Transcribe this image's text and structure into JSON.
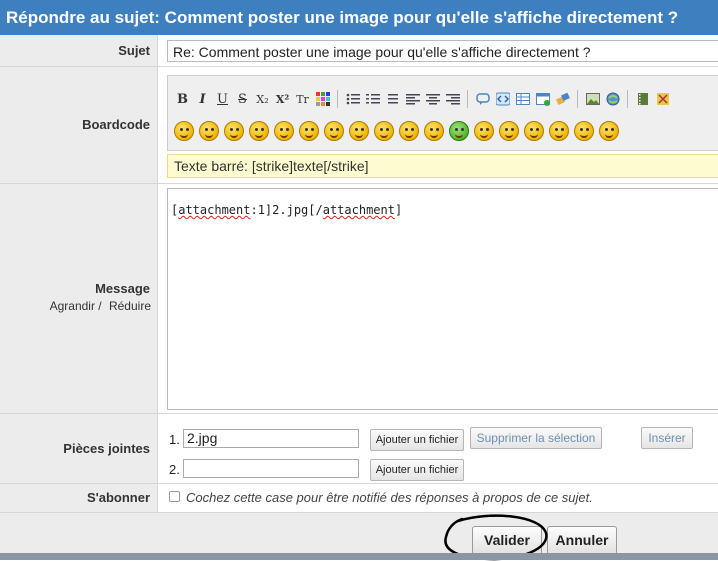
{
  "header": {
    "title": "Répondre au sujet: Comment poster une image pour qu'elle s'affiche directement ?"
  },
  "subject": {
    "label": "Sujet",
    "value": "Re: Comment poster une image pour qu'elle s'affiche directement ?"
  },
  "boardcode": {
    "label": "Boardcode",
    "format_buttons": [
      "B",
      "I",
      "U",
      "S",
      "X₂",
      "X²",
      "Tr"
    ],
    "hint": "Texte barré: [strike]texte[/strike]",
    "smiley_count": 18
  },
  "message": {
    "label": "Message",
    "resize_grow": "Agrandir /",
    "resize_shrink": "Réduire",
    "text_open_tag": "attachment",
    "text_prefix": "[",
    "text_middle": ":1]2.jpg[/",
    "text_close_tag": "attachment",
    "text_suffix": "]"
  },
  "attachments": {
    "label": "Pièces jointes",
    "rows": [
      {
        "index": "1.",
        "value": "2.jpg"
      },
      {
        "index": "2.",
        "value": ""
      }
    ],
    "add_file": "Ajouter un fichier",
    "remove_selection": "Supprimer la sélection",
    "insert": "Insérer"
  },
  "subscribe": {
    "label": "S'abonner",
    "note": "Cochez cette case pour être notifié des réponses à propos de ce sujet."
  },
  "actions": {
    "submit": "Valider",
    "cancel": "Annuler"
  }
}
